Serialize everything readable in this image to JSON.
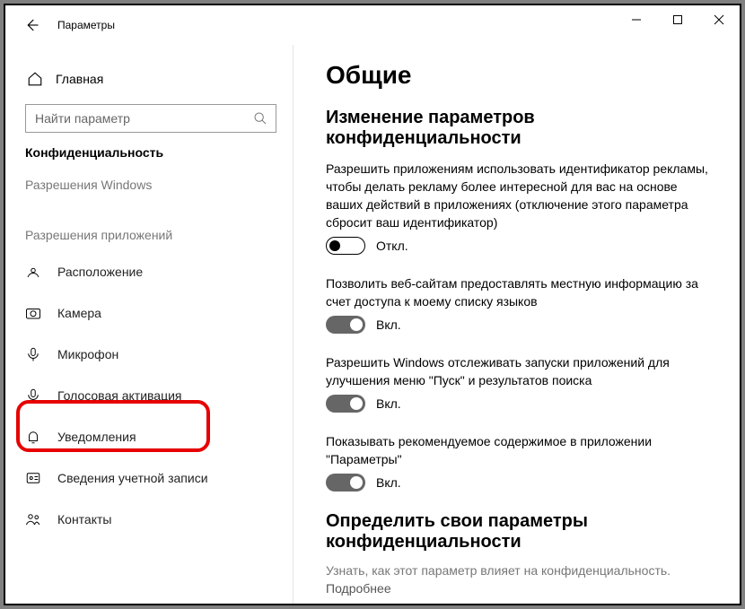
{
  "title": "Параметры",
  "sidebar": {
    "home": "Главная",
    "search_placeholder": "Найти параметр",
    "section_current": "Конфиденциальность",
    "group_windows": "Разрешения Windows",
    "group_apps": "Разрешения приложений",
    "items": [
      {
        "label": "Расположение"
      },
      {
        "label": "Камера"
      },
      {
        "label": "Микрофон"
      },
      {
        "label": "Голосовая активация"
      },
      {
        "label": "Уведомления"
      },
      {
        "label": "Сведения учетной записи"
      },
      {
        "label": "Контакты"
      }
    ]
  },
  "content": {
    "heading": "Общие",
    "subheading": "Изменение параметров конфиденциальности",
    "settings": [
      {
        "text": "Разрешить приложениям использовать идентификатор рекламы, чтобы делать рекламу более интересной для вас на основе ваших действий в приложениях (отключение этого параметра сбросит ваш идентификатор)",
        "on": false,
        "label": "Откл."
      },
      {
        "text": "Позволить веб-сайтам предоставлять местную информацию за счет доступа к моему списку языков",
        "on": true,
        "label": "Вкл."
      },
      {
        "text": "Разрешить Windows отслеживать запуски приложений для улучшения меню \"Пуск\" и результатов поиска",
        "on": true,
        "label": "Вкл."
      },
      {
        "text": "Показывать рекомендуемое содержимое в приложении \"Параметры\"",
        "on": true,
        "label": "Вкл."
      }
    ],
    "footer_heading": "Определить свои параметры конфиденциальности",
    "footer_text": "Узнать, как этот параметр влияет на конфиденциальность.",
    "footer_link": "Подробнее"
  }
}
